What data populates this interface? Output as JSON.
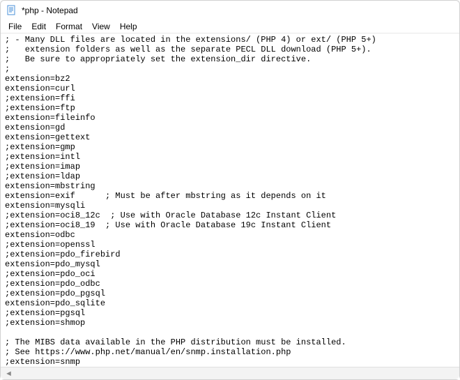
{
  "window": {
    "title": "*php - Notepad",
    "icon": "notepad-icon"
  },
  "menu": {
    "items": [
      {
        "label": "File"
      },
      {
        "label": "Edit"
      },
      {
        "label": "Format"
      },
      {
        "label": "View"
      },
      {
        "label": "Help"
      }
    ]
  },
  "editor": {
    "content": "; - Many DLL files are located in the extensions/ (PHP 4) or ext/ (PHP 5+)\n;   extension folders as well as the separate PECL DLL download (PHP 5+).\n;   Be sure to appropriately set the extension_dir directive.\n;\nextension=bz2\nextension=curl\n;extension=ffi\n;extension=ftp\nextension=fileinfo\nextension=gd\nextension=gettext\n;extension=gmp\n;extension=intl\n;extension=imap\n;extension=ldap\nextension=mbstring\nextension=exif      ; Must be after mbstring as it depends on it\nextension=mysqli\n;extension=oci8_12c  ; Use with Oracle Database 12c Instant Client\n;extension=oci8_19  ; Use with Oracle Database 19c Instant Client\nextension=odbc\n;extension=openssl\n;extension=pdo_firebird\nextension=pdo_mysql\n;extension=pdo_oci\n;extension=pdo_odbc\n;extension=pdo_pgsql\nextension=pdo_sqlite\n;extension=pgsql\n;extension=shmop\n\n; The MIBS data available in the PHP distribution must be installed.\n; See https://www.php.net/manual/en/snmp.installation.php\n;extension=snmp\n\n;extension=soap"
  },
  "statusbar": {
    "indicator": "◄"
  }
}
